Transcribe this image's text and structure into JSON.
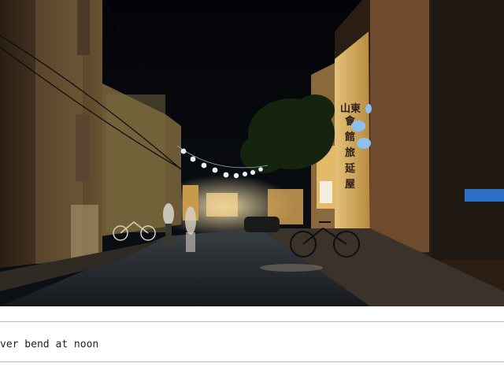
{
  "photo": {
    "subject": "night-street-scene",
    "sign_text": [
      "山東",
      "會",
      "館",
      "旅",
      "延",
      "屋"
    ],
    "colors": {
      "sky": "#05070c",
      "wall_warm": "#c9a35e",
      "lantern": "#cfe6ff",
      "road": "#1c1f23"
    }
  },
  "caption": {
    "text": "ver bend at noon"
  }
}
